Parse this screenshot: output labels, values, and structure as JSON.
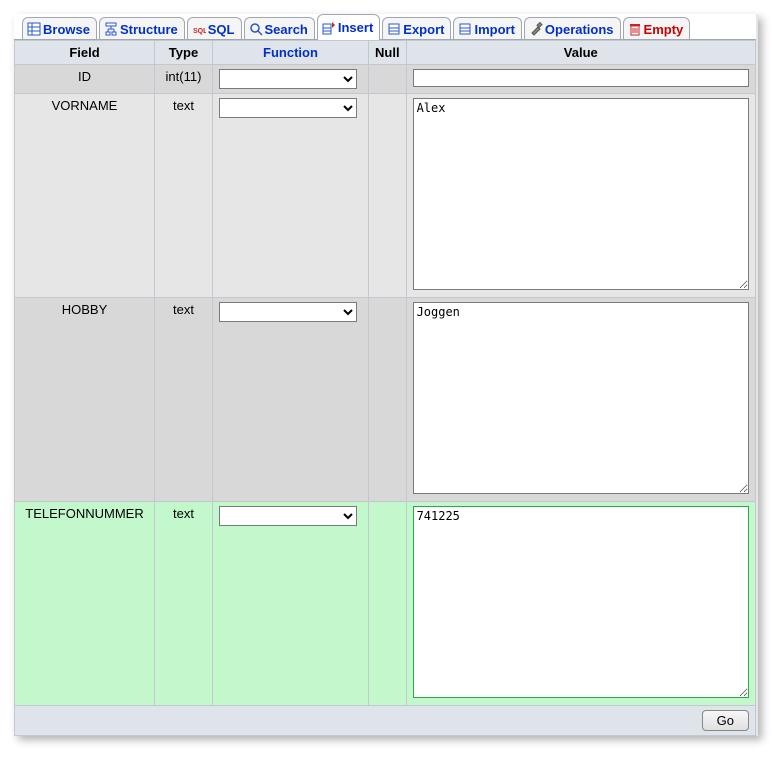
{
  "tabs": {
    "browse": "Browse",
    "structure": "Structure",
    "sql": "SQL",
    "search": "Search",
    "insert": "Insert",
    "export": "Export",
    "import": "Import",
    "operations": "Operations",
    "empty": "Empty"
  },
  "headers": {
    "field": "Field",
    "type": "Type",
    "function": "Function",
    "null": "Null",
    "value": "Value"
  },
  "rows": [
    {
      "field": "ID",
      "type": "int(11)",
      "function": "",
      "value": ""
    },
    {
      "field": "VORNAME",
      "type": "text",
      "function": "",
      "value": "Alex"
    },
    {
      "field": "HOBBY",
      "type": "text",
      "function": "",
      "value": "Joggen"
    },
    {
      "field": "TELEFONNUMMER",
      "type": "text",
      "function": "",
      "value": "741225"
    }
  ],
  "buttons": {
    "go": "Go"
  }
}
